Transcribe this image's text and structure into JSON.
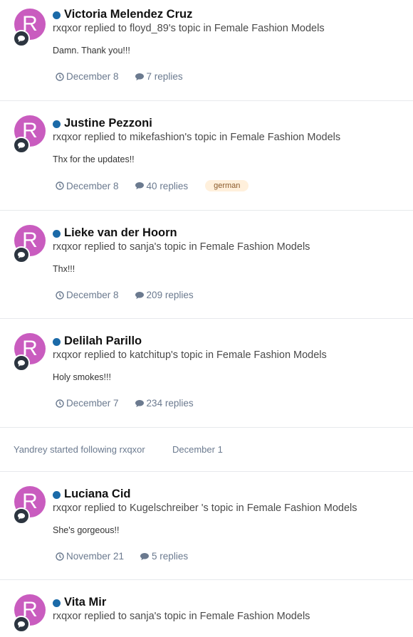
{
  "feed": {
    "items": [
      {
        "avatar_letter": "R",
        "title": "Victoria Melendez Cruz",
        "action": "rxqxor replied to floyd_89's topic in Female Fashion Models",
        "snippet": "Damn. Thank you!!!",
        "date": "December 8",
        "replies": "7 replies",
        "tag": ""
      },
      {
        "avatar_letter": "R",
        "title": "Justine Pezzoni",
        "action": "rxqxor replied to mikefashion's topic in Female Fashion Models",
        "snippet": "Thx for the updates!!",
        "date": "December 8",
        "replies": "40 replies",
        "tag": "german"
      },
      {
        "avatar_letter": "R",
        "title": "Lieke van der Hoorn",
        "action": "rxqxor replied to sanja's topic in Female Fashion Models",
        "snippet": "Thx!!!",
        "date": "December 8",
        "replies": "209 replies",
        "tag": ""
      },
      {
        "avatar_letter": "R",
        "title": "Delilah Parillo",
        "action": "rxqxor replied to katchitup's topic in Female Fashion Models",
        "snippet": "Holy smokes!!!",
        "date": "December 7",
        "replies": "234 replies",
        "tag": ""
      }
    ],
    "follow": {
      "text": "Yandrey started following rxqxor",
      "date": "December 1"
    },
    "items2": [
      {
        "avatar_letter": "R",
        "title": "Luciana Cid",
        "action": "rxqxor replied to Kugelschreiber 's topic in Female Fashion Models",
        "snippet": "She's gorgeous!!",
        "date": "November 21",
        "replies": "5 replies",
        "tag": ""
      },
      {
        "avatar_letter": "R",
        "title": "Vita Mir",
        "action": "rxqxor replied to sanja's topic in Female Fashion Models"
      }
    ]
  },
  "colors": {
    "avatar_bg": "#c95cbf",
    "online_dot": "#1b6aa8",
    "meta_text": "#6b7a8f",
    "tag_bg": "#fff0dc"
  },
  "icons": {
    "clock": "clock-icon",
    "replies": "comment-icon",
    "activity": "comment-bubble-icon",
    "online": "online-indicator-icon"
  }
}
